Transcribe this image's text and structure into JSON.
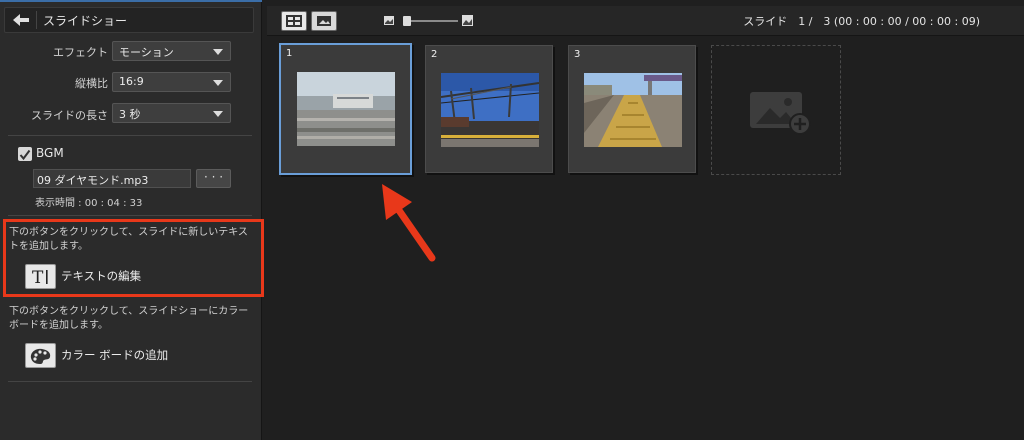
{
  "panel": {
    "title": "スライドショー",
    "effect": {
      "label": "エフェクト",
      "value": "モーション"
    },
    "aspect": {
      "label": "縦横比",
      "value": "16:9"
    },
    "length": {
      "label": "スライドの長さ",
      "value": "3 秒"
    },
    "bgm": {
      "label": "BGM",
      "checked": true,
      "file": "09 ダイヤモンド.mp3",
      "browse_label": "· · ·",
      "duration": "表示時間 : 00 : 04 : 33"
    },
    "text_section": {
      "description": "下のボタンをクリックして、スライドに新しいテキストを追加します。",
      "button_label": "テキストの編集"
    },
    "color_section": {
      "description": "下のボタンをクリックして、スライドショーにカラー ボードを追加します。",
      "button_label": "カラー ボードの追加"
    }
  },
  "toolbar": {
    "slide_info": "スライド　1 /　3 (00 : 00 : 00 / 00 : 00 : 09)"
  },
  "slides": [
    {
      "number": "1",
      "selected": true
    },
    {
      "number": "2",
      "selected": false
    },
    {
      "number": "3",
      "selected": false
    }
  ],
  "colors": {
    "highlight": "#e8381a",
    "selection": "#6a9ed8",
    "accent": "#3b6ea8"
  },
  "icons": [
    "back-arrow-icon",
    "thumbnail-view-icon",
    "image-view-icon",
    "small-image-icon",
    "large-image-icon",
    "text-icon",
    "palette-icon",
    "add-image-icon",
    "red-arrow"
  ]
}
